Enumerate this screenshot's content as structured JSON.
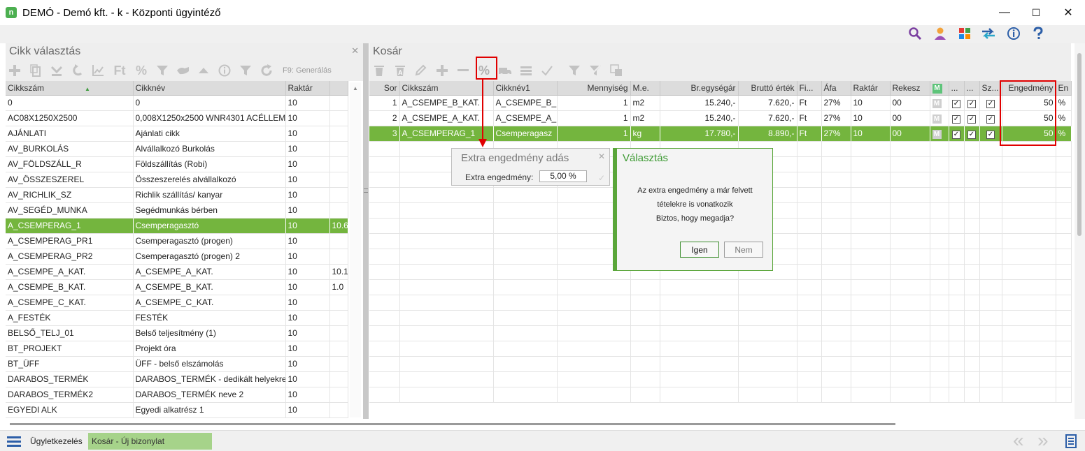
{
  "window": {
    "title": "DEMÓ - Demó kft. - k - Központi ügyintéző",
    "app_icon": "n",
    "min": "—",
    "max": "☐",
    "close": "✕"
  },
  "header_icons": [
    "search-icon",
    "user-icon",
    "apps-icon",
    "switch-icon",
    "info-icon",
    "help-icon"
  ],
  "left_panel": {
    "title": "Cikk választás",
    "close": "✕",
    "toolbar_text": "F9: Generálás",
    "ft": "Ft",
    "pct": "%",
    "columns": [
      "Cikkszám",
      "Cikknév",
      "Raktár",
      ""
    ],
    "rows": [
      [
        "0",
        "0",
        "10",
        ""
      ],
      [
        "AC08X1250X2500",
        "0,008X1250x2500 WNR4301 ACÉLLEMEZ",
        "10",
        ""
      ],
      [
        "AJÁNLATI",
        "Ajánlati cikk",
        "10",
        ""
      ],
      [
        "AV_BURKOLÁS",
        "Alvállalkozó Burkolás",
        "10",
        ""
      ],
      [
        "AV_FÖLDSZÁLL_R",
        "Földszállítás (Robi)",
        "10",
        ""
      ],
      [
        "AV_ÖSSZESZEREL",
        "Összeszerelés alvállalkozó",
        "10",
        ""
      ],
      [
        "AV_RICHLIK_SZ",
        "Richlik szállítás/ kanyar",
        "10",
        ""
      ],
      [
        "AV_SEGÉD_MUNKA",
        "Segédmunkás bérben",
        "10",
        ""
      ],
      [
        "A_CSEMPERAG_1",
        "Csemperagasztó",
        "10",
        "10.6"
      ],
      [
        "A_CSEMPERAG_PR1",
        "Csemperagasztó (progen)",
        "10",
        ""
      ],
      [
        "A_CSEMPERAG_PR2",
        "Csemperagasztó (progen) 2",
        "10",
        ""
      ],
      [
        "A_CSEMPE_A_KAT.",
        "A_CSEMPE_A_KAT.",
        "10",
        "10.1"
      ],
      [
        "A_CSEMPE_B_KAT.",
        "A_CSEMPE_B_KAT.",
        "10",
        "1.0"
      ],
      [
        "A_CSEMPE_C_KAT.",
        "A_CSEMPE_C_KAT.",
        "10",
        ""
      ],
      [
        "A_FESTÉK",
        "FESTÉK",
        "10",
        ""
      ],
      [
        "BELSŐ_TELJ_01",
        "Belső teljesítmény (1)",
        "10",
        ""
      ],
      [
        "BT_PROJEKT",
        "Projekt óra",
        "10",
        ""
      ],
      [
        "BT_ÜFF",
        "ÜFF - belső elszámolás",
        "10",
        ""
      ],
      [
        "DARABOS_TERMÉK",
        "DARABOS_TERMÉK - dedikált helyekre",
        "10",
        ""
      ],
      [
        "DARABOS_TERMÉK2",
        "DARABOS_TERMÉK neve 2",
        "10",
        ""
      ],
      [
        "EGYEDI ALK",
        "Egyedi alkatrész 1",
        "10",
        ""
      ]
    ],
    "selected_row": 8
  },
  "right_panel": {
    "title": "Kosár",
    "pct": "%",
    "columns": [
      "Sor",
      "Cikkszám",
      "Cikknév1",
      "Mennyiség",
      "M.e.",
      "Br.egységár",
      "Bruttó érték",
      "Fi...",
      "Áfa",
      "Raktár",
      "Rekesz",
      "M",
      "...",
      "...",
      "Sz...",
      "Engedmény",
      "En"
    ],
    "rows": [
      [
        "1",
        "A_CSEMPE_B_KAT.",
        "A_CSEMPE_B_",
        "1",
        "m2",
        "15.240,-",
        "7.620,-",
        "Ft",
        "27%",
        "10",
        "00",
        "M",
        "✓",
        "✓",
        "✓",
        "50",
        "%"
      ],
      [
        "2",
        "A_CSEMPE_A_KAT.",
        "A_CSEMPE_A_",
        "1",
        "m2",
        "15.240,-",
        "7.620,-",
        "Ft",
        "27%",
        "10",
        "00",
        "M",
        "✓",
        "✓",
        "✓",
        "50",
        "%"
      ],
      [
        "3",
        "A_CSEMPERAG_1",
        "Csemperagasz",
        "1",
        "kg",
        "17.780,-",
        "8.890,-",
        "Ft",
        "27%",
        "10",
        "00",
        "M",
        "✓",
        "✓",
        "✓",
        "50",
        "%"
      ]
    ],
    "selected_row": 2,
    "empty_rows": 17
  },
  "extra_dialog": {
    "title": "Extra engedmény adás",
    "close": "✕",
    "label": "Extra engedmény:",
    "value": "5,00 %",
    "ok": "✓"
  },
  "confirm_dialog": {
    "title": "Választás",
    "line1": "Az extra engedmény a már felvett",
    "line2": "tételekre is vonatkozik",
    "line3": "Biztos, hogy megadja?",
    "yes": "Igen",
    "no": "Nem"
  },
  "bottom": {
    "tab1": "Ügyletkezelés",
    "tab2": "Kosár - Új bizonylat",
    "prev": "«",
    "next": "»"
  },
  "colors": {
    "accent_green": "#74b53e",
    "highlight_red": "#e00000",
    "dialog_green": "#5aa63a"
  }
}
